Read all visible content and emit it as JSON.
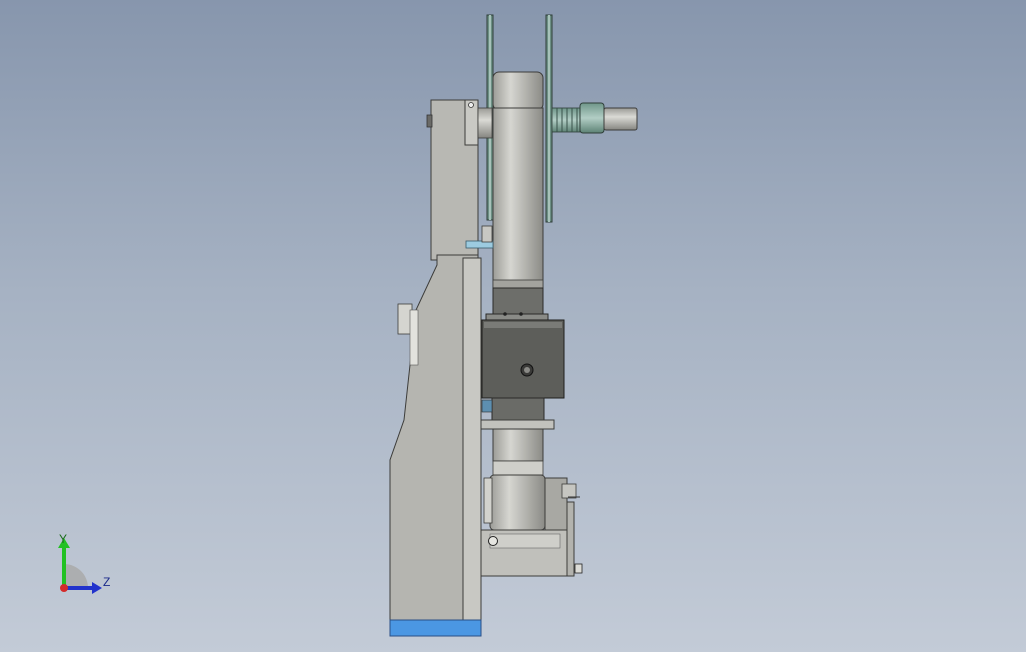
{
  "triad": {
    "y_label": "Y",
    "z_label": "Z",
    "y_icon": "y-axis-arrow-icon",
    "z_icon": "z-axis-arrow-icon",
    "x_icon": "x-axis-dot-icon"
  },
  "colors": {
    "background_top": "#8796ad",
    "background_bottom": "#c3cbd7",
    "part_gray": "#b9b9b4",
    "dark_block": "#5a5b57",
    "base_blue": "#4b97e3",
    "spring_green": "#7fa79a",
    "y_axis": "#22c122",
    "z_axis": "#2233cc",
    "x_origin": "#d42a2a"
  }
}
